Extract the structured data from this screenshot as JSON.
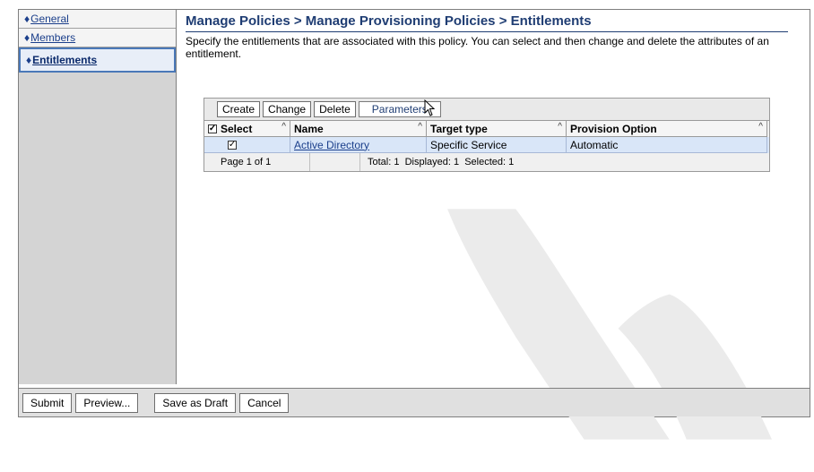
{
  "sidebar": {
    "items": [
      {
        "label": "General",
        "active": false
      },
      {
        "label": "Members",
        "active": false
      },
      {
        "label": "Entitlements",
        "active": true
      }
    ]
  },
  "main": {
    "breadcrumb": "Manage Policies > Manage Provisioning Policies > Entitlements",
    "description": "Specify the entitlements that are associated with this policy. You can select and then change and delete the attributes of an entitlement."
  },
  "toolbar": {
    "create_label": "Create",
    "change_label": "Change",
    "delete_label": "Delete",
    "parameters_label": "Parameters"
  },
  "table": {
    "headers": {
      "select": "Select",
      "name": "Name",
      "target_type": "Target type",
      "provision_option": "Provision Option"
    },
    "rows": [
      {
        "selected": true,
        "name": "Active Directory",
        "target_type": "Specific Service",
        "provision_option": "Automatic"
      }
    ],
    "footer": {
      "page": "Page 1 of 1",
      "summary": "Total: 1  Displayed: 1  Selected: 1"
    }
  },
  "bottom": {
    "submit_label": "Submit",
    "preview_label": "Preview...",
    "save_draft_label": "Save as Draft",
    "cancel_label": "Cancel"
  },
  "colors": {
    "accent": "#1f3d73",
    "selected_row": "#d9e6f8",
    "sidebar_bg": "#d4d4d4"
  }
}
